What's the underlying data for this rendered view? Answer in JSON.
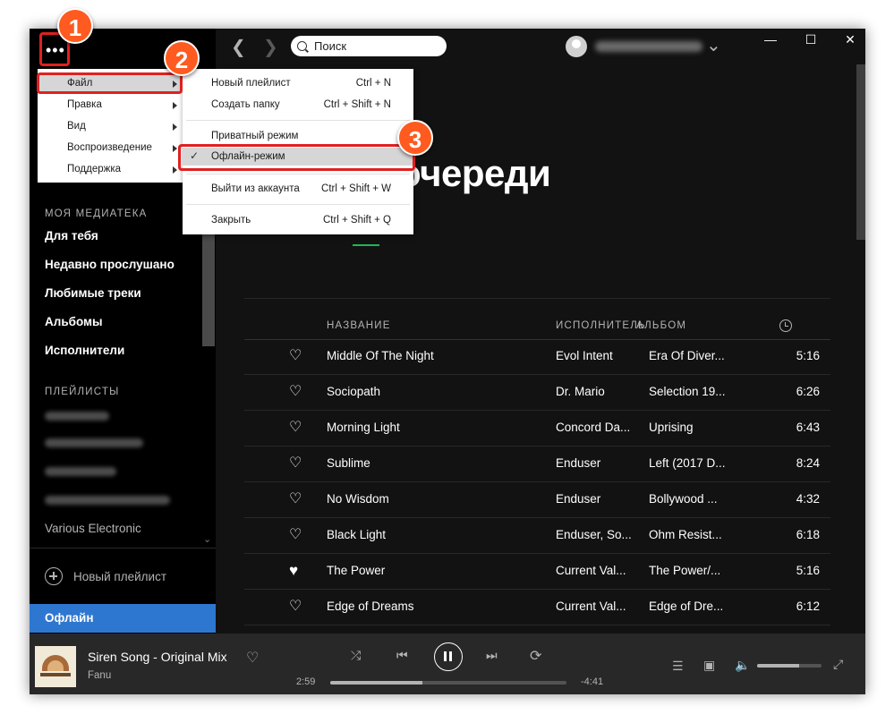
{
  "sidebar": {
    "library_label": "МОЯ МЕДИАТЕКА",
    "library_items": [
      "Для тебя",
      "Недавно прослушано",
      "Любимые треки",
      "Альбомы",
      "Исполнители"
    ],
    "playlists_label": "ПЛЕЙЛИСТЫ",
    "visible_playlist": "Various Electronic",
    "new_playlist": "Новый плейлист",
    "offline_item": "Офлайн"
  },
  "topbar": {
    "search_placeholder": "Поиск"
  },
  "main": {
    "title_fragment": "очереди",
    "columns": {
      "title": "НАЗВАНИЕ",
      "artist": "ИСПОЛНИТЕЛЬ",
      "album": "АЛЬБОМ"
    },
    "tracks": [
      {
        "title": "Middle Of The Night",
        "artist": "Evol Intent",
        "album": "Era Of Diver...",
        "duration": "5:16",
        "liked": false
      },
      {
        "title": "Sociopath",
        "artist": "Dr. Mario",
        "album": "Selection 19...",
        "duration": "6:26",
        "liked": false
      },
      {
        "title": "Morning Light",
        "artist": "Concord Da...",
        "album": "Uprising",
        "duration": "6:43",
        "liked": false
      },
      {
        "title": "Sublime",
        "artist": "Enduser",
        "album": "Left (2017 D...",
        "duration": "8:24",
        "liked": false
      },
      {
        "title": "No Wisdom",
        "artist": "Enduser",
        "album": "Bollywood ...",
        "duration": "4:32",
        "liked": false
      },
      {
        "title": "Black Light",
        "artist": "Enduser, So...",
        "album": "Ohm Resist...",
        "duration": "6:18",
        "liked": false
      },
      {
        "title": "The Power",
        "artist": "Current Val...",
        "album": "The Power/...",
        "duration": "5:16",
        "liked": true
      },
      {
        "title": "Edge of Dreams",
        "artist": "Current Val...",
        "album": "Edge of Dre...",
        "duration": "6:12",
        "liked": false
      }
    ]
  },
  "player": {
    "track_title": "Siren Song - Original Mix",
    "artist": "Fanu",
    "elapsed": "2:59",
    "remaining": "-4:41",
    "progress_fraction": 0.39,
    "volume_fraction": 0.65
  },
  "menu_main": {
    "items": [
      "Файл",
      "Правка",
      "Вид",
      "Воспроизведение",
      "Поддержка"
    ]
  },
  "menu_file": {
    "items": [
      {
        "label": "Новый плейлист",
        "shortcut": "Ctrl + N"
      },
      {
        "label": "Создать папку",
        "shortcut": "Ctrl + Shift + N"
      },
      {
        "label": "Приватный режим",
        "shortcut": ""
      },
      {
        "label": "Офлайн-режим",
        "shortcut": "",
        "checked": true
      },
      {
        "label": "Выйти из аккаунта",
        "shortcut": "Ctrl + Shift + W"
      },
      {
        "label": "Закрыть",
        "shortcut": "Ctrl + Shift + Q"
      }
    ]
  },
  "annotations": {
    "badges": [
      "1",
      "2",
      "3"
    ],
    "color": "#ff5a1f",
    "outline_color": "#e02020"
  },
  "colors": {
    "accent": "#1db954",
    "selected": "#2e77d0"
  }
}
